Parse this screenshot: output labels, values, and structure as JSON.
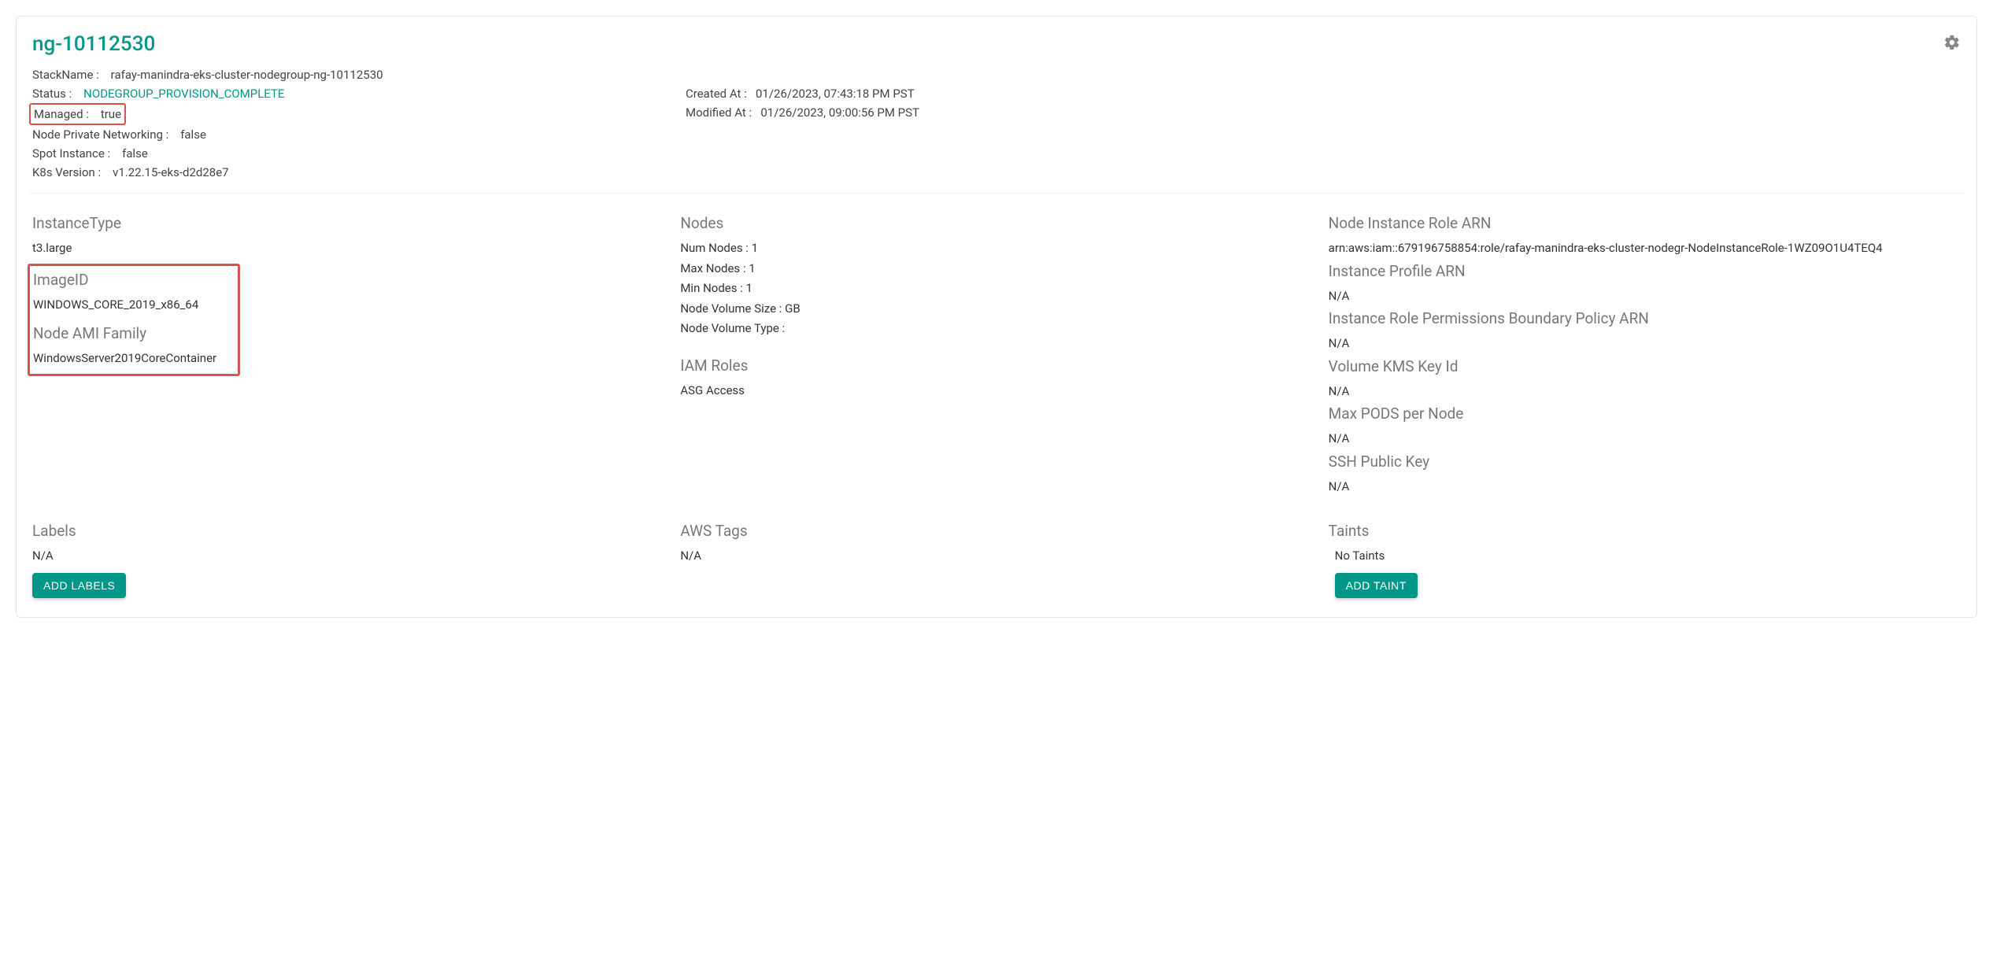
{
  "title": "ng-10112530",
  "meta": {
    "stackname_label": "StackName :",
    "stackname_value": "rafay-manindra-eks-cluster-nodegroup-ng-10112530",
    "status_label": "Status :",
    "status_value": "NODEGROUP_PROVISION_COMPLETE",
    "managed_label": "Managed :",
    "managed_value": "true",
    "npn_label": "Node Private Networking :",
    "npn_value": "false",
    "spot_label": "Spot Instance :",
    "spot_value": "false",
    "k8s_label": "K8s Version :",
    "k8s_value": "v1.22.15-eks-d2d28e7",
    "created_label": "Created At :",
    "created_value": "01/26/2023, 07:43:18 PM PST",
    "modified_label": "Modified At :",
    "modified_value": "01/26/2023, 09:00:56 PM PST"
  },
  "col1": {
    "instancetype_label": "InstanceType",
    "instancetype_value": "t3.large",
    "imageid_label": "ImageID",
    "imageid_value": "WINDOWS_CORE_2019_x86_64",
    "amifam_label": "Node AMI Family",
    "amifam_value": "WindowsServer2019CoreContainer"
  },
  "col2": {
    "nodes_label": "Nodes",
    "num_nodes": "Num Nodes : 1",
    "max_nodes": "Max Nodes : 1",
    "min_nodes": "Min Nodes : 1",
    "vol_size": "Node Volume Size :   GB",
    "vol_type": "Node Volume Type :",
    "iam_label": "IAM Roles",
    "iam_value": "ASG Access"
  },
  "col3": {
    "role_arn_label": "Node Instance Role ARN",
    "role_arn_value": "arn:aws:iam::679196758854:role/rafay-manindra-eks-cluster-nodegr-NodeInstanceRole-1WZ09O1U4TEQ4",
    "profile_arn_label": "Instance Profile ARN",
    "profile_arn_value": "N/A",
    "perm_boundary_label": "Instance Role Permissions Boundary Policy ARN",
    "perm_boundary_value": "N/A",
    "kms_label": "Volume KMS Key Id",
    "kms_value": "N/A",
    "maxpods_label": "Max PODS per Node",
    "maxpods_value": "N/A",
    "ssh_label": "SSH Public Key",
    "ssh_value": "N/A"
  },
  "bottom": {
    "labels_label": "Labels",
    "labels_value": "N/A",
    "add_labels_btn": "ADD LABELS",
    "tags_label": "AWS Tags",
    "tags_value": "N/A",
    "taints_label": "Taints",
    "taints_value": "No Taints",
    "add_taint_btn": "ADD TAINT"
  }
}
